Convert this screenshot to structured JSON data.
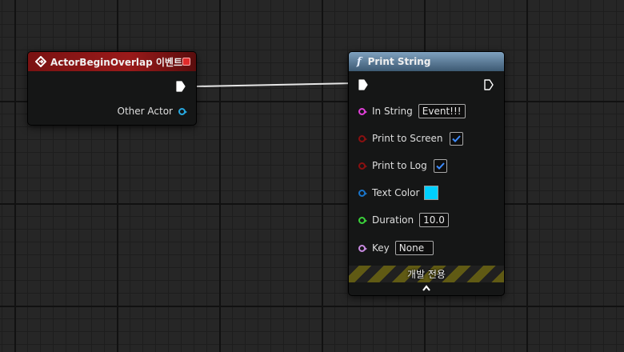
{
  "event_node": {
    "title": "ActorBeginOverlap 이벤트",
    "other_actor_label": "Other Actor",
    "pin_color": "#27a9e1"
  },
  "print_node": {
    "title": "Print String",
    "pins": {
      "in_string": {
        "label": "In String",
        "value": "Event!!!",
        "color": "#e03fd8"
      },
      "print_to_screen": {
        "label": "Print to Screen",
        "checked": true,
        "color": "#8a1010"
      },
      "print_to_log": {
        "label": "Print to Log",
        "checked": true,
        "color": "#8a1010"
      },
      "text_color": {
        "label": "Text Color",
        "swatch": "#00d0ff",
        "color": "#1a74c8"
      },
      "duration": {
        "label": "Duration",
        "value": "10.0",
        "color": "#3ad13a"
      },
      "key": {
        "label": "Key",
        "value": "None",
        "color": "#c88ae0"
      }
    },
    "dev_only_label": "개발 전용"
  },
  "icons": {
    "event": "event-diamond-icon",
    "function": "function-icon",
    "exec": "exec-pin-icon",
    "expand": "chevron-up-icon"
  }
}
